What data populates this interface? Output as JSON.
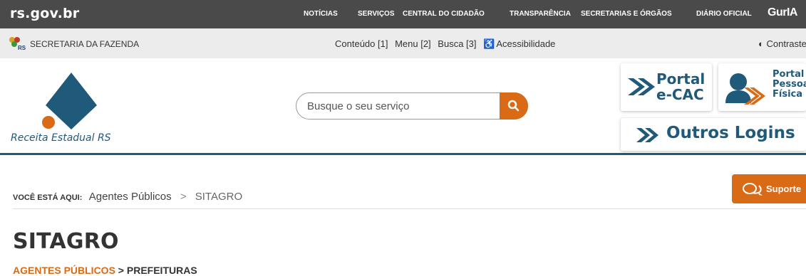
{
  "topbar": {
    "brand": "rs.gov.br",
    "nav": [
      "NOTÍCIAS",
      "SERVIÇOS",
      "CENTRAL DO CIDADÃO",
      "TRANSPARÊNCIA",
      "SECRETARIAS E ÓRGÃOS",
      "DIÁRIO OFICIAL"
    ],
    "gurla": "GurIA"
  },
  "secbar": {
    "name": "SECRETARIA DA FAZENDA",
    "logo_text": "RS",
    "links": [
      "Conteúdo [1]",
      "Menu [2]",
      "Busca [3]",
      "Acessibilidade"
    ],
    "contrast": "Contraste"
  },
  "header": {
    "logo_text": "Receita Estadual RS",
    "search_placeholder": "Busque o seu serviço",
    "cards": {
      "ecac_line1": "Portal",
      "ecac_line2": "e-CAC",
      "pf_line1": "Portal",
      "pf_line2": "Pessoa",
      "pf_line3": "Física",
      "outros": "Outros Logins"
    }
  },
  "breadcrumb": {
    "label": "VOCÊ ESTÁ AQUI:",
    "items": [
      "Agentes Públicos",
      "SITAGRO"
    ],
    "separator": ">"
  },
  "suporte": "Suporte",
  "page": {
    "title": "SITAGRO",
    "sub_a": "AGENTES PÚBLICOS",
    "sub_sep": ">",
    "sub_b": "PREFEITURAS"
  },
  "colors": {
    "accent": "#d96a16",
    "brand_blue": "#1f5a7a",
    "topbar": "#4a4a4a"
  }
}
